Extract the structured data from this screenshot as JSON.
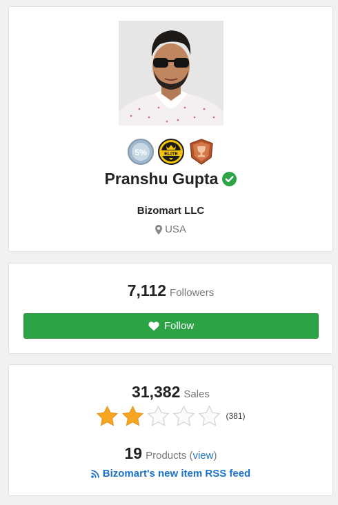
{
  "profile": {
    "name": "Pranshu Gupta",
    "company": "Bizomart LLC",
    "location": "USA",
    "badges": [
      {
        "icon": "top-5-percent-badge-icon",
        "text": "5%"
      },
      {
        "icon": "elite-author-badge-icon",
        "text": "ELITE"
      },
      {
        "icon": "trophy-badge-icon"
      }
    ],
    "verified_icon": "check-circle-icon"
  },
  "followers": {
    "count": "7,112",
    "label": "Followers",
    "follow_button_label": "Follow"
  },
  "sales": {
    "count": "31,382",
    "label": "Sales",
    "rating_stars": 2,
    "rating_max": 5,
    "rating_count": "(381)",
    "products_count": "19",
    "products_label": "Products (",
    "view_link": "view",
    "products_close": ")",
    "rss_label": "Bizomart's new item RSS feed"
  },
  "colors": {
    "accent_green": "#2ca446",
    "link_blue": "#1a73c9",
    "star_gold": "#f6a623"
  }
}
